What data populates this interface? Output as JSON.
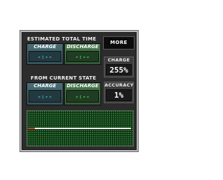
{
  "estimated": {
    "title": "ESTIMATED TOTAL TIME",
    "charge_label": "CHARGE",
    "charge_value": "-:--",
    "discharge_label": "DISCHARGE",
    "discharge_value": "-:--"
  },
  "current": {
    "title": "FROM CURRENT STATE",
    "charge_label": "CHARGE",
    "charge_value": "-:--",
    "discharge_label": "DISCHARGE",
    "discharge_value": "-:--"
  },
  "more_button": {
    "label": "MORE"
  },
  "charge_stat": {
    "label": "CHARGE",
    "value": "255%"
  },
  "accuracy_stat": {
    "label": "ACCURACY",
    "value": "1%"
  },
  "graph": {
    "line_colors": {
      "start": "#d83a2a",
      "rest": "#f2f2f2"
    },
    "grid_color": "#2f8a3a",
    "background": "#0e2a12"
  }
}
